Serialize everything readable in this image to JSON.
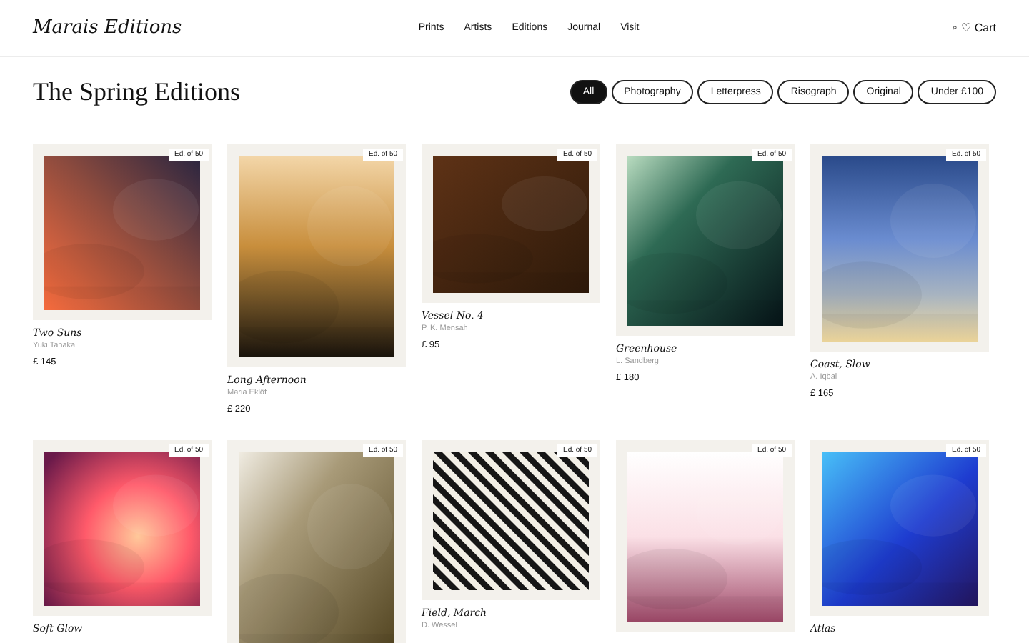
{
  "header": {
    "brand": "Marais Editions",
    "nav": [
      {
        "label": "Prints"
      },
      {
        "label": "Artists"
      },
      {
        "label": "Editions"
      },
      {
        "label": "Journal"
      },
      {
        "label": "Visit"
      }
    ],
    "search_icon": "⌕",
    "cart": "♡ Cart"
  },
  "page_title": "The Spring Editions",
  "filters": [
    {
      "label": "All",
      "selected": true
    },
    {
      "label": "Photography",
      "selected": false
    },
    {
      "label": "Letterpress",
      "selected": false
    },
    {
      "label": "Risograph",
      "selected": false
    },
    {
      "label": "Original",
      "selected": false
    },
    {
      "label": "Under £100",
      "selected": false
    }
  ],
  "prints": [
    {
      "badge": "Ed. of 50",
      "title": "Two Suns",
      "artist": "Yuki Tanaka",
      "price": "£ 145",
      "kind": "picture"
    },
    {
      "badge": "Ed. of 50",
      "title": "Long Afternoon",
      "artist": "Maria Eklöf",
      "price": "£ 220",
      "kind": "picture"
    },
    {
      "badge": "Ed. of 50",
      "title": "Vessel No. 4",
      "artist": "P. K. Mensah",
      "price": "£ 95",
      "kind": "picture"
    },
    {
      "badge": "Ed. of 50",
      "title": "Greenhouse",
      "artist": "L. Sandberg",
      "price": "£ 180",
      "kind": "picture"
    },
    {
      "badge": "Ed. of 50",
      "title": "Coast, Slow",
      "artist": "A. Iqbal",
      "price": "£ 165",
      "kind": "picture"
    },
    {
      "badge": "Ed. of 50",
      "title": "Soft Glow",
      "kind": "picture"
    },
    {
      "badge": "Ed. of 50",
      "kind": "picture"
    },
    {
      "badge": "Ed. of 50",
      "title": "Field, March",
      "artist": "D. Wessel",
      "kind": "picture"
    },
    {
      "badge": "Ed. of 50",
      "kind": "picture"
    },
    {
      "badge": "Ed. of 50",
      "title": "Atlas",
      "kind": "picture"
    }
  ]
}
